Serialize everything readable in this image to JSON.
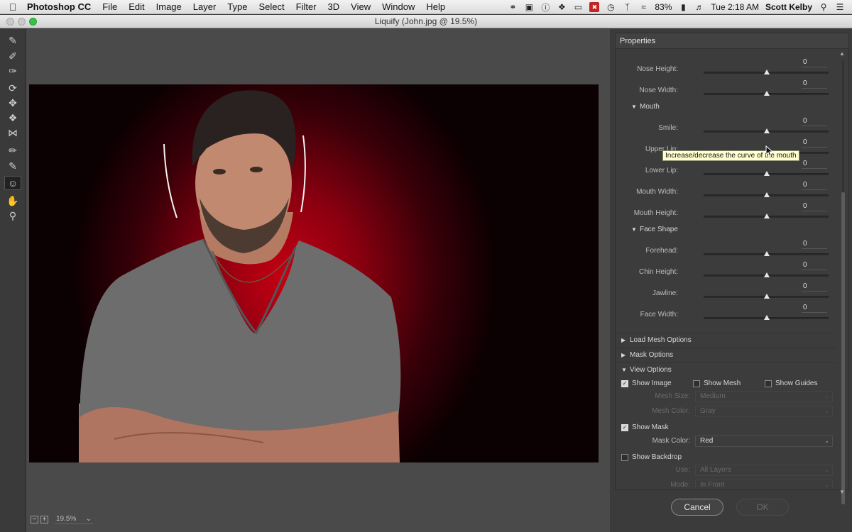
{
  "menubar": {
    "app": "Photoshop CC",
    "menus": [
      "File",
      "Edit",
      "Image",
      "Layer",
      "Type",
      "Select",
      "Filter",
      "3D",
      "View",
      "Window",
      "Help"
    ],
    "status_icons": [
      "creative-cloud-icon",
      "camera-icon",
      "info-icon",
      "dropbox-icon",
      "airplay-icon",
      "blocked-icon",
      "time-machine-icon",
      "bluetooth-icon",
      "wifi-icon"
    ],
    "battery": "83%",
    "clock": "Tue 2:18 AM",
    "user": "Scott Kelby"
  },
  "window": {
    "title": "Liquify (John.jpg @ 19.5%)"
  },
  "tools": [
    "forward-warp-tool",
    "reconstruct-tool",
    "smooth-tool",
    "twirl-clockwise-tool",
    "pucker-tool",
    "bloat-tool",
    "push-left-tool",
    "freeze-mask-tool",
    "thaw-mask-tool",
    "face-tool",
    "hand-tool",
    "zoom-tool"
  ],
  "canvas": {
    "zoom": "19.5%"
  },
  "panel": {
    "title": "Properties",
    "nose": {
      "height_label": "Nose Height:",
      "height_value": "0",
      "width_label": "Nose Width:",
      "width_value": "0"
    },
    "mouth": {
      "header": "Mouth",
      "smile_label": "Smile:",
      "smile_value": "0",
      "upper_lip_label": "Upper Lip:",
      "upper_lip_value": "0",
      "lower_lip_label": "Lower Lip:",
      "lower_lip_value": "0",
      "mouth_width_label": "Mouth Width:",
      "mouth_width_value": "0",
      "mouth_height_label": "Mouth Height:",
      "mouth_height_value": "0"
    },
    "face_shape": {
      "header": "Face Shape",
      "forehead_label": "Forehead:",
      "forehead_value": "0",
      "chin_height_label": "Chin Height:",
      "chin_height_value": "0",
      "jawline_label": "Jawline:",
      "jawline_value": "0",
      "face_width_label": "Face Width:",
      "face_width_value": "0"
    },
    "tooltip": "Increase/decrease the curve of the mouth",
    "load_mesh": "Load Mesh Options",
    "mask_options": "Mask Options",
    "view_options": {
      "header": "View Options",
      "show_image": "Show Image",
      "show_mesh": "Show Mesh",
      "show_guides": "Show Guides",
      "mesh_size_label": "Mesh Size:",
      "mesh_size_value": "Medium",
      "mesh_color_label": "Mesh Color:",
      "mesh_color_value": "Gray",
      "show_mask": "Show Mask",
      "mask_color_label": "Mask Color:",
      "mask_color_value": "Red",
      "show_backdrop": "Show Backdrop",
      "use_label": "Use:",
      "use_value": "All Layers",
      "mode_label": "Mode:",
      "mode_value": "In Front"
    }
  },
  "buttons": {
    "cancel": "Cancel",
    "ok": "OK"
  }
}
